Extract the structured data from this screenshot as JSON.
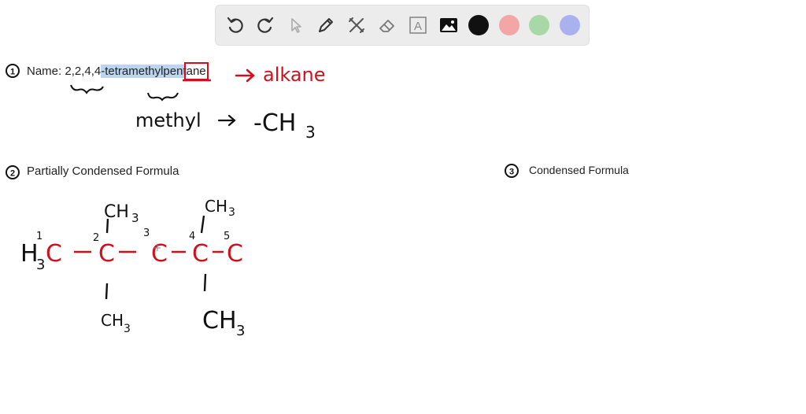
{
  "toolbar": {
    "tools": [
      {
        "name": "undo-icon"
      },
      {
        "name": "redo-icon"
      },
      {
        "name": "pointer-icon"
      },
      {
        "name": "pen-icon"
      },
      {
        "name": "tools-icon"
      },
      {
        "name": "eraser-icon"
      },
      {
        "name": "text-box-icon",
        "glyph": "A"
      },
      {
        "name": "image-icon"
      }
    ],
    "colors": [
      "#111111",
      "#f3a6a6",
      "#a8d8a8",
      "#a9b2ee"
    ]
  },
  "step1": {
    "number": "1",
    "label": "Name: ",
    "name_prefix": "2,2,4,4",
    "name_highlight": "-tetramethylpent",
    "name_suffix": "ane",
    "annotation_alkane": "alkane",
    "annotation_methyl": "methyl",
    "annotation_ch3": "-CH",
    "annotation_ch3_sub": "3"
  },
  "step2": {
    "number": "2",
    "title": "Partially Condensed Formula",
    "structure": {
      "h3": "H",
      "h3_sub": "3",
      "carbon": "C",
      "numbers": [
        "1",
        "2",
        "3",
        "4",
        "5"
      ],
      "top_groups": [
        "CH",
        "CH"
      ],
      "bottom_groups": [
        "CH",
        "CH"
      ],
      "sub": "3"
    }
  },
  "step3": {
    "number": "3",
    "title": "Condensed Formula"
  },
  "colors": {
    "ink": "#111111",
    "red_ink": "#d0101c",
    "highlight": "#bcd4ee"
  }
}
